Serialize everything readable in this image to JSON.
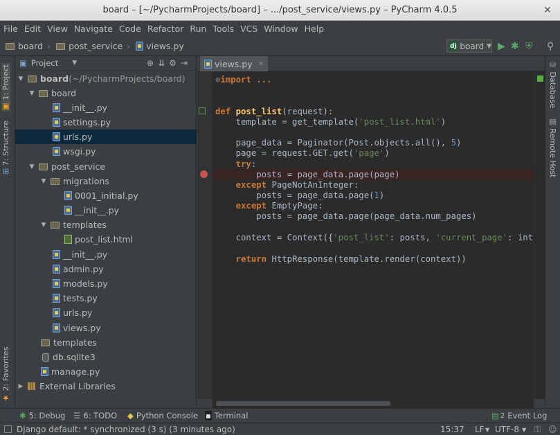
{
  "window": {
    "title": "board – [~/PycharmProjects/board] – .../post_service/views.py – PyCharm 4.0.5"
  },
  "menu": [
    "File",
    "Edit",
    "View",
    "Navigate",
    "Code",
    "Refactor",
    "Run",
    "Tools",
    "VCS",
    "Window",
    "Help"
  ],
  "breadcrumb": [
    "board",
    "post_service",
    "views.py"
  ],
  "run_config": {
    "label": "board",
    "icon": "dj"
  },
  "left_tabs": {
    "project": "1: Project",
    "structure": "7: Structure",
    "favorites": "2: Favorites"
  },
  "right_tabs": {
    "database": "Database",
    "remote_host": "Remote Host"
  },
  "project_panel": {
    "header": "Project",
    "tree": [
      {
        "label": "board",
        "suffix": " (~/PycharmProjects/board)",
        "type": "folder",
        "expanded": true
      },
      {
        "label": "board",
        "type": "folder",
        "expanded": true
      },
      {
        "label": "__init__.py",
        "type": "py"
      },
      {
        "label": "settings.py",
        "type": "py"
      },
      {
        "label": "urls.py",
        "type": "py",
        "selected": true
      },
      {
        "label": "wsgi.py",
        "type": "py"
      },
      {
        "label": "post_service",
        "type": "folder",
        "expanded": true
      },
      {
        "label": "migrations",
        "type": "folder",
        "expanded": true
      },
      {
        "label": "0001_initial.py",
        "type": "py"
      },
      {
        "label": "__init__.py",
        "type": "py"
      },
      {
        "label": "templates",
        "type": "folder",
        "expanded": true
      },
      {
        "label": "post_list.html",
        "type": "html"
      },
      {
        "label": "__init__.py",
        "type": "py"
      },
      {
        "label": "admin.py",
        "type": "py"
      },
      {
        "label": "models.py",
        "type": "py"
      },
      {
        "label": "tests.py",
        "type": "py"
      },
      {
        "label": "urls.py",
        "type": "py"
      },
      {
        "label": "views.py",
        "type": "py"
      },
      {
        "label": "templates",
        "type": "folder"
      },
      {
        "label": "db.sqlite3",
        "type": "db"
      },
      {
        "label": "manage.py",
        "type": "py"
      },
      {
        "label": "External Libraries",
        "type": "lib",
        "expanded": false
      }
    ]
  },
  "editor": {
    "tab": "views.py",
    "code": {
      "l1": "import ...",
      "l4": [
        "def",
        "post_list",
        "(request):"
      ],
      "l5": [
        "    template = get_template(",
        "'post_list.html'",
        ")"
      ],
      "l7": [
        "    page_data = Paginator(Post.objects.all(), ",
        "5",
        ")"
      ],
      "l8": [
        "    page = request.GET.get(",
        "'page'",
        ")"
      ],
      "l9": [
        "    ",
        "try",
        ":"
      ],
      "l10": [
        "        posts = page_data.page(page)"
      ],
      "l11": [
        "    ",
        "except",
        " PageNotAnInteger:"
      ],
      "l12": [
        "        posts = page_data.page(",
        "1",
        ")"
      ],
      "l13": [
        "    ",
        "except",
        " EmptyPage:"
      ],
      "l14": [
        "        posts = page_data.page(page_data.num_pages)"
      ],
      "l16": [
        "    context = Context({",
        "'post_list'",
        ": posts, ",
        "'current_page'",
        ": int(page)"
      ],
      "l18": [
        "    ",
        "return",
        " HttpResponse(template.render(context))"
      ]
    }
  },
  "tool_windows": [
    {
      "key": "5",
      "label": "5: Debug"
    },
    {
      "key": "6",
      "label": "6: TODO"
    },
    {
      "label": "Python Console"
    },
    {
      "label": "Terminal"
    },
    {
      "label": "Event Log",
      "badge": "2"
    }
  ],
  "status": {
    "message": "Django default: * synchronized (3 s) (3 minutes ago)",
    "position": "15:37",
    "line_sep": "LF",
    "encoding": "UTF-8"
  }
}
